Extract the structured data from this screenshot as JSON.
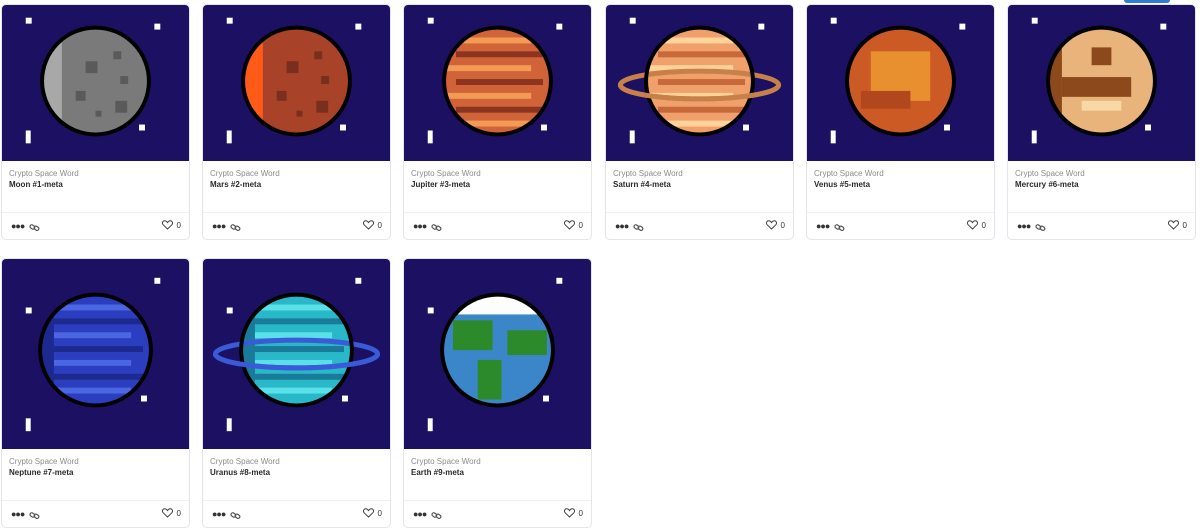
{
  "cards": [
    {
      "collection": "Crypto Space Word",
      "name": "Moon #1-meta",
      "likes": "0",
      "planet": "moon-icon",
      "colors": {
        "base": "#7a7a7a",
        "light": "#a8a8a8",
        "spot": "#5a5a5a"
      }
    },
    {
      "collection": "Crypto Space Word",
      "name": "Mars #2-meta",
      "likes": "0",
      "planet": "mars-icon",
      "colors": {
        "base": "#a8432a",
        "light": "#ff5a16",
        "spot": "#7a2e1e"
      }
    },
    {
      "collection": "Crypto Space Word",
      "name": "Jupiter #3-meta",
      "likes": "0",
      "planet": "jupiter-icon",
      "colors": {
        "base": "#d06438",
        "light": "#f39a55",
        "spot": "#8c3420"
      }
    },
    {
      "collection": "Crypto Space Word",
      "name": "Saturn #4-meta",
      "likes": "0",
      "planet": "saturn-icon",
      "colors": {
        "base": "#f0a06a",
        "light": "#ffd39a",
        "spot": "#c8693c"
      }
    },
    {
      "collection": "Crypto Space Word",
      "name": "Venus #5-meta",
      "likes": "0",
      "planet": "venus-icon",
      "colors": {
        "base": "#cc5a24",
        "light": "#e89030",
        "spot": "#b2461c"
      }
    },
    {
      "collection": "Crypto Space Word",
      "name": "Mercury #6-meta",
      "likes": "0",
      "planet": "mercury-icon",
      "colors": {
        "base": "#e8b47c",
        "light": "#f8d8a4",
        "spot": "#8c4a1c"
      }
    },
    {
      "collection": "Crypto Space Word",
      "name": "Neptune #7-meta",
      "likes": "0",
      "planet": "neptune-icon",
      "colors": {
        "base": "#2c3ec0",
        "light": "#4a66e0",
        "spot": "#1c2a90"
      }
    },
    {
      "collection": "Crypto Space Word",
      "name": "Uranus #8-meta",
      "likes": "0",
      "planet": "uranus-icon",
      "colors": {
        "base": "#28b8c8",
        "light": "#5ae0e8",
        "spot": "#1a7a9a"
      }
    },
    {
      "collection": "Crypto Space Word",
      "name": "Earth #9-meta",
      "likes": "0",
      "planet": "earth-icon",
      "colors": {
        "base": "#3a86c8",
        "light": "#2d8a2a",
        "spot": "#ffffff"
      }
    }
  ]
}
